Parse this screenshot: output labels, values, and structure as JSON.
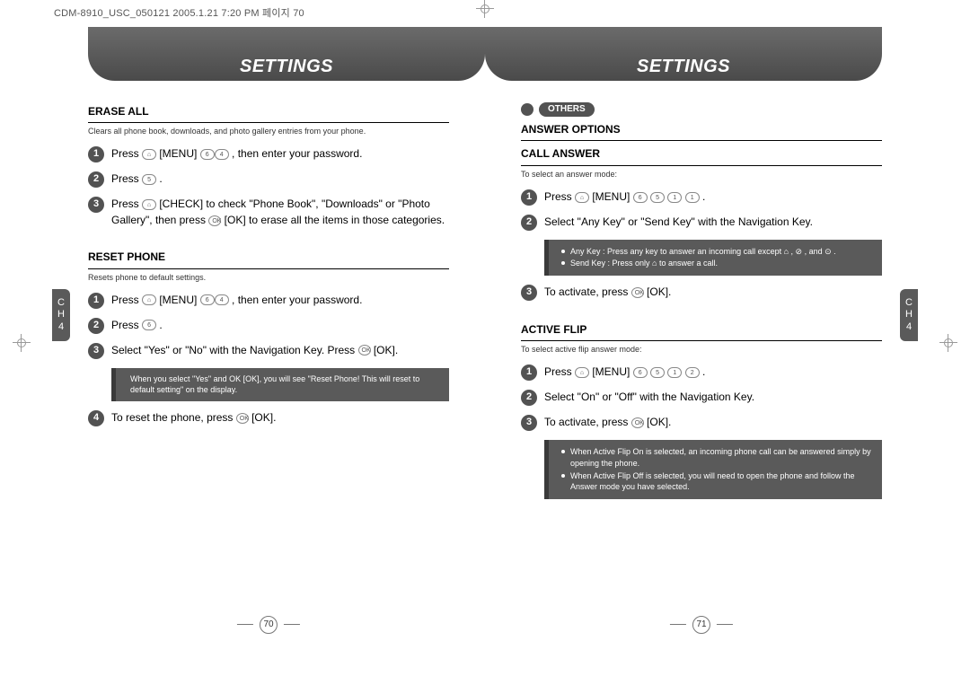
{
  "doc_header": "CDM-8910_USC_050121  2005.1.21  7:20 PM  페이지 70",
  "banner_title": "SETTINGS",
  "side_tab": {
    "c": "C",
    "h": "H",
    "n": "4"
  },
  "left_page": {
    "page_num": "70",
    "erase_all": {
      "title": "ERASE ALL",
      "sub": "Clears all phone book, downloads, and photo gallery entries from your phone.",
      "steps": [
        "Press ⌂ [MENU] 6 4 , then enter your password.",
        "Press 5 .",
        "Press ⌂ [CHECK] to check \"Phone Book\", \"Downloads\" or \"Photo Gallery\", then press OK [OK] to erase all the items in those categories."
      ]
    },
    "reset_phone": {
      "title": "RESET PHONE",
      "sub": "Resets phone to default settings.",
      "steps": [
        "Press ⌂ [MENU] 6 4 , then enter your password.",
        "Press 6 .",
        "Select \"Yes\" or \"No\" with the Navigation Key. Press OK [OK].",
        "To reset the phone, press OK [OK]."
      ],
      "note": "When you select \"Yes\" and OK [OK], you will see \"Reset Phone! This will reset to default setting\" on the display."
    }
  },
  "right_page": {
    "page_num": "71",
    "others_pill": "OTHERS",
    "answer_options": {
      "title": "ANSWER OPTIONS",
      "call_answer": {
        "title": "CALL ANSWER",
        "sub": "To select an answer mode:",
        "steps": [
          "Press ⌂ [MENU] 6 5 1 1 .",
          "Select \"Any Key\" or \"Send Key\" with the Navigation Key.",
          "To activate, press OK [OK]."
        ],
        "note_lines": [
          "Any Key : Press any key to answer an incoming call except ⌂ , ⊘ , and ⊙ .",
          "Send Key : Press only ⌂ to answer a call."
        ]
      },
      "active_flip": {
        "title": "ACTIVE FLIP",
        "sub": "To select active flip answer mode:",
        "steps": [
          "Press ⌂ [MENU] 6 5 1 2 .",
          "Select \"On\" or \"Off\" with the Navigation Key.",
          "To activate, press OK [OK]."
        ],
        "note_lines": [
          "When Active Flip On is selected, an incoming phone call can be answered simply by opening the phone.",
          "When Active Flip Off is selected, you will need to open the phone and follow the Answer mode you have selected."
        ]
      }
    }
  }
}
